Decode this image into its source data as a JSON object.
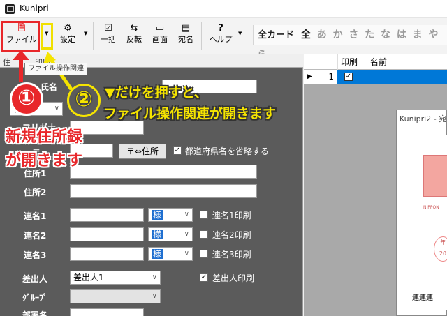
{
  "window": {
    "title": "Kunipri"
  },
  "toolbar": {
    "file": "ファイル",
    "settings": "設定",
    "bulk": "一括",
    "flip": "反転",
    "screen": "画面",
    "address": "宛名",
    "help": "ヘルプ",
    "help_icon": "?",
    "all_cards": "全カード",
    "all": "全",
    "kana": [
      "あ",
      "か",
      "さ",
      "た",
      "な",
      "は",
      "ま",
      "や",
      "ら"
    ]
  },
  "icons": {
    "file": "document-icon",
    "settings": "gear-icon",
    "bulk": "checkbox-icon",
    "flip": "swap-arrows-icon",
    "screen": "monitor-icon",
    "address": "address-card-icon",
    "help": "question-icon"
  },
  "tooltip": "ファイル操作関連",
  "tabs": [
    "住",
    "印刷"
  ],
  "form": {
    "labels": {
      "name": "氏名",
      "furigana": "フリガナ",
      "zip": "〒",
      "address1": "住所1",
      "address2": "住所2",
      "joint1": "連名1",
      "joint2": "連名2",
      "joint3": "連名3",
      "sender": "差出人",
      "group": "ｸﾞﾙｰﾌﾟ",
      "department": "部署名"
    },
    "honorific_name": "名",
    "honorific": "様",
    "zip_button": "〒⇔住所",
    "omit_pref": "都道府県名を省略する",
    "joint1_print": "連名1印刷",
    "joint2_print": "連名2印刷",
    "joint3_print": "連名3印刷",
    "sender_value": "差出人1",
    "sender_print": "差出人印刷",
    "checkmark": "✓"
  },
  "grid": {
    "columns": [
      "印刷",
      "名前"
    ],
    "rows": [
      {
        "num": "1",
        "print": true
      }
    ]
  },
  "preview": {
    "title": "Kunipri2 - 宛",
    "nippon": "NIPPON",
    "postmark_1": "年",
    "postmark_2": "20",
    "address_line": "連連連"
  },
  "annotations": {
    "step1_num": "①",
    "step1_text_line1": "新規住所録",
    "step1_text_line2": "が開きます",
    "step2_num": "②",
    "step2_text_line1": "▼だけを押すと、",
    "step2_text_line2": "ファイル操作関連が開きます"
  },
  "colors": {
    "red": "#e8272a",
    "yellow": "#f5e400",
    "panel": "#5b5b5b",
    "selection": "#0078d7"
  }
}
